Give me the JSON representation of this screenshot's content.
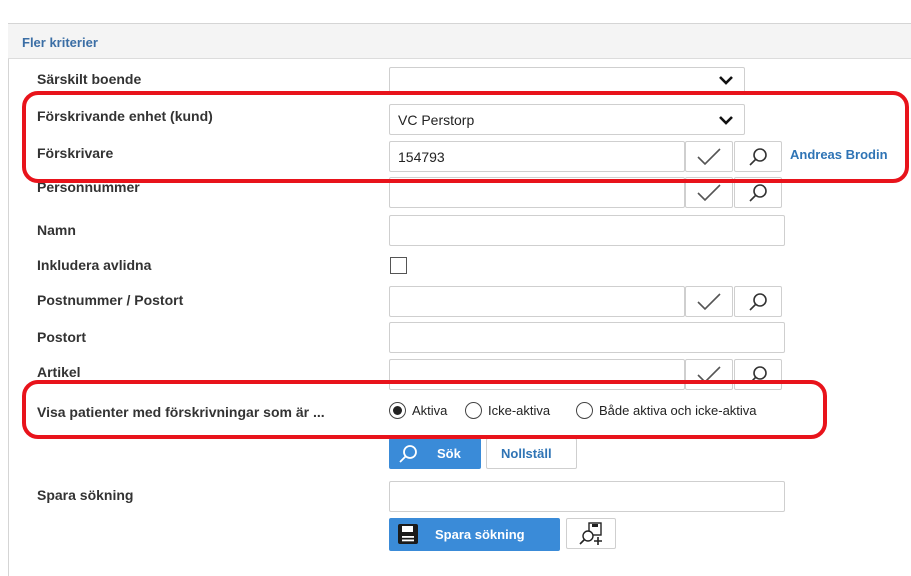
{
  "panel": {
    "title": "Fler kriterier"
  },
  "fields": {
    "sarskilt_boende": {
      "label": "Särskilt boende",
      "value": ""
    },
    "enhet": {
      "label": "Förskrivande enhet (kund)",
      "value": "VC Perstorp"
    },
    "forskrivare": {
      "label": "Förskrivare",
      "value": "154793",
      "link": "Andreas Brodin"
    },
    "personnummer": {
      "label": "Personnummer",
      "value": ""
    },
    "namn": {
      "label": "Namn",
      "value": ""
    },
    "inkludera_avlidna": {
      "label": "Inkludera avlidna",
      "checked": false
    },
    "postnummer": {
      "label": "Postnummer / Postort",
      "value": ""
    },
    "postort": {
      "label": "Postort",
      "value": ""
    },
    "artikel": {
      "label": "Artikel",
      "value": ""
    },
    "visa": {
      "label": "Visa patienter med förskrivningar som är ...",
      "options": [
        "Aktiva",
        "Icke-aktiva",
        "Både aktiva och icke-aktiva"
      ],
      "selected": "Aktiva"
    }
  },
  "actions": {
    "search": "Sök",
    "reset": "Nollställ"
  },
  "save": {
    "label": "Spara sökning",
    "value": "",
    "button": "Spara sökning"
  },
  "icons": {
    "chevron": "chevron-down-icon",
    "check": "check-icon",
    "search": "search-icon",
    "save": "floppy-disk-icon",
    "saved_search": "saved-search-add-icon"
  },
  "colors": {
    "link": "#2f74b5",
    "primary": "#3a8bd8",
    "highlight": "#e8131b"
  }
}
